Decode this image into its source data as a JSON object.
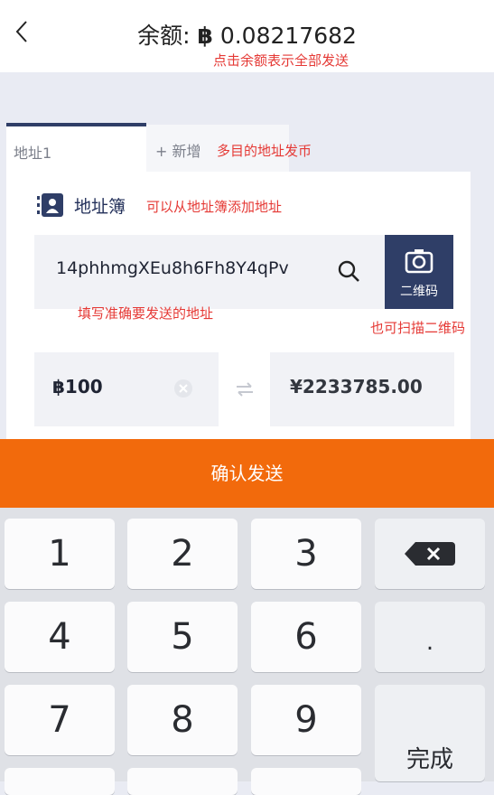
{
  "header": {
    "back_icon": "chevron-left-icon",
    "balance_label": "余额:",
    "balance_currency": "฿",
    "balance_amount": "0.08217682",
    "balance_note": "点击余额表示全部发送"
  },
  "tabs": [
    {
      "label": "地址1",
      "active": true
    },
    {
      "label": "+ 新增",
      "active": false
    }
  ],
  "tabs_note": "多目的地址发币",
  "address_book": {
    "icon": "contact-book-icon",
    "label": "地址簿",
    "note": "可以从地址簿添加地址"
  },
  "address": {
    "value": "14phhmgXEu8h6Fh8Y4qPv",
    "note": "填写准确要发送的地址",
    "search_icon": "search-icon"
  },
  "qr": {
    "icon": "camera-icon",
    "label": "二维码",
    "note": "也可扫描二维码"
  },
  "amount": {
    "btc": "฿100",
    "cny": "¥2233785.00",
    "clear_icon": "clear-circle-icon",
    "swap_icon": "swap-arrows-icon"
  },
  "confirm_label": "确认发送",
  "keyboard": {
    "keys": [
      "1",
      "2",
      "3",
      "4",
      "5",
      "6",
      "7",
      "8",
      "9"
    ],
    "backspace_icon": "backspace-icon",
    "dot": ".",
    "done": "完成"
  },
  "colors": {
    "accent": "#f26a0c",
    "primary": "#2f3e67",
    "note": "#e53935"
  }
}
